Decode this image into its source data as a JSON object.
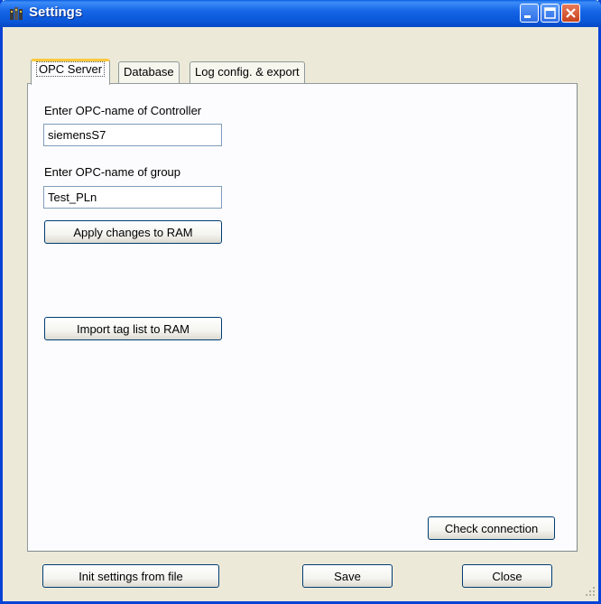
{
  "window": {
    "title": "Settings"
  },
  "tabs": [
    {
      "label": "OPC Server",
      "active": true
    },
    {
      "label": "Database",
      "active": false
    },
    {
      "label": "Log config. & export",
      "active": false
    }
  ],
  "opc": {
    "controller_label": "Enter OPC-name of Controller",
    "controller_value": "siemensS7",
    "group_label": "Enter OPC-name of group",
    "group_value": "Test_PLn",
    "apply_button": "Apply changes to RAM",
    "import_button": "Import tag list to RAM",
    "check_button": "Check connection"
  },
  "footer": {
    "init_button": "Init settings from file",
    "save_button": "Save",
    "close_button": "Close"
  },
  "icons": {
    "title": "settings-window-icon",
    "minimize": "minimize-icon",
    "maximize": "maximize-icon",
    "close": "close-icon"
  },
  "colors": {
    "titlebar": "#0a56d8",
    "window_bg": "#ece9d8",
    "tab_active_highlight": "#ffc83c",
    "close_button": "#c8431c"
  }
}
